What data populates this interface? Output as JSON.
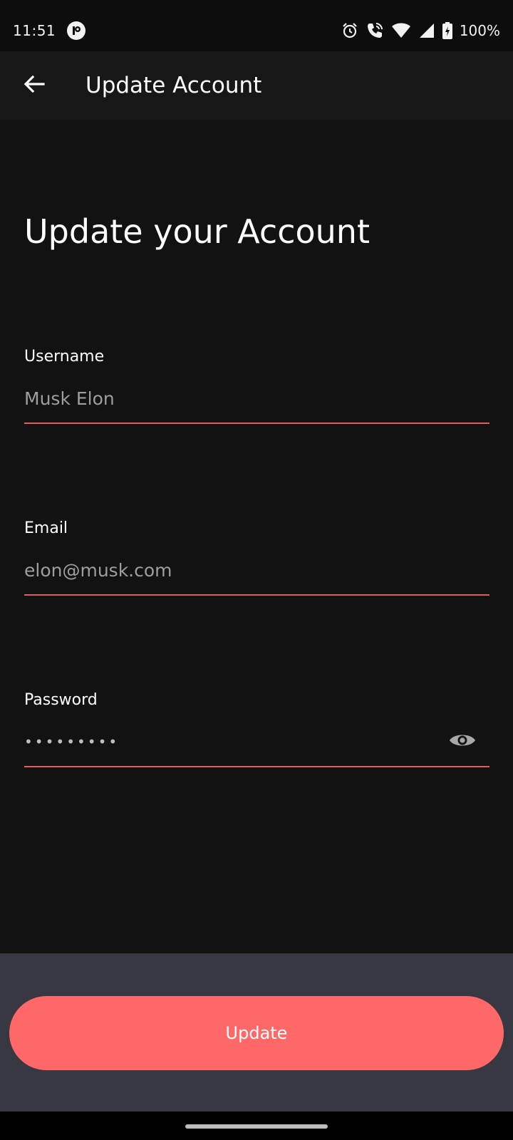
{
  "status_bar": {
    "time": "11:51",
    "battery": "100%",
    "icons": [
      "app-notification-icon",
      "alarm-icon",
      "wifi-call-icon",
      "wifi-icon",
      "signal-icon",
      "battery-charging-icon"
    ]
  },
  "app_bar": {
    "back_icon": "arrow-left-icon",
    "title": "Update Account"
  },
  "form": {
    "heading": "Update your Account",
    "username": {
      "label": "Username",
      "value": "Musk Elon"
    },
    "email": {
      "label": "Email",
      "value": "elon@musk.com"
    },
    "password": {
      "label": "Password",
      "value": "•••••••••",
      "toggle_icon": "eye-icon"
    }
  },
  "actions": {
    "update_label": "Update"
  },
  "colors": {
    "background": "#121212",
    "app_bar": "#171717",
    "accent": "#ff6868",
    "underline": "#e25c5c",
    "bottom_panel": "#373841"
  }
}
